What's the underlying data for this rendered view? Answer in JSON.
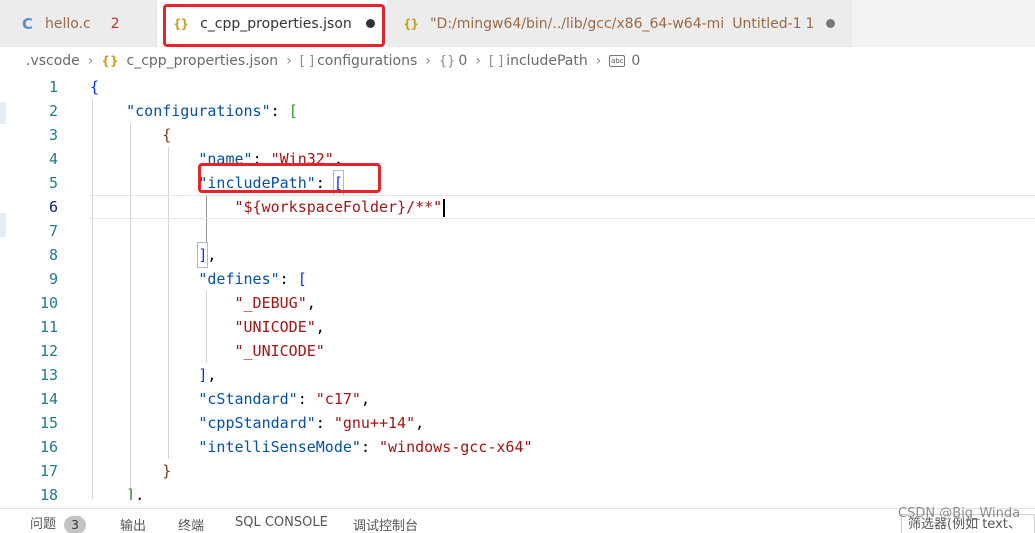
{
  "tabs": {
    "hello": {
      "icon": "C",
      "label": "hello.c",
      "badge": "2"
    },
    "props": {
      "icon": "{}",
      "label": "c_cpp_properties.json"
    },
    "mingw": {
      "icon": "{}",
      "label": "\"D:/mingw64/bin/../lib/gcc/x86_64-w64-mi",
      "label2": "Untitled-1",
      "count": "1"
    }
  },
  "breadcrumb": {
    "folder": ".vscode",
    "file_icon": "{}",
    "file": "c_cpp_properties.json",
    "arr1_icon": "[ ]",
    "configurations": "configurations",
    "obj_icon": "{}",
    "index0": "0",
    "arr2_icon": "[ ]",
    "includePath": "includePath",
    "str_icon": "abc",
    "index1": "0"
  },
  "editor": {
    "line_numbers": [
      "1",
      "2",
      "3",
      "4",
      "5",
      "6",
      "7",
      "8",
      "9",
      "10",
      "11",
      "12",
      "13",
      "14",
      "15",
      "16",
      "17",
      "18"
    ],
    "tokens": {
      "configurations": "\"configurations\"",
      "name": "\"name\"",
      "win32": "\"Win32\"",
      "includePath": "\"includePath\"",
      "workspaceFolder": "\"${workspaceFolder}/**\"",
      "defines": "\"defines\"",
      "debug": "\"_DEBUG\"",
      "unicode1": "\"UNICODE\"",
      "unicode2": "\"_UNICODE\"",
      "cStandard": "\"cStandard\"",
      "c17": "\"c17\"",
      "cppStandard": "\"cppStandard\"",
      "gnu14": "\"gnu++14\"",
      "intelliSenseMode": "\"intelliSenseMode\"",
      "gccx64": "\"windows-gcc-x64\""
    }
  },
  "panel": {
    "problems": "问题",
    "problems_count": "3",
    "output": "输出",
    "terminal": "终端",
    "sql_console": "SQL CONSOLE",
    "debug_console": "调试控制台",
    "filter_placeholder": "筛选器(例如 text、"
  },
  "watermark": "CSDN @Big_Winda",
  "colors": {
    "highlight": "#e8222a",
    "key": "#0451a5",
    "string": "#a31515",
    "line_number": "#237893"
  }
}
